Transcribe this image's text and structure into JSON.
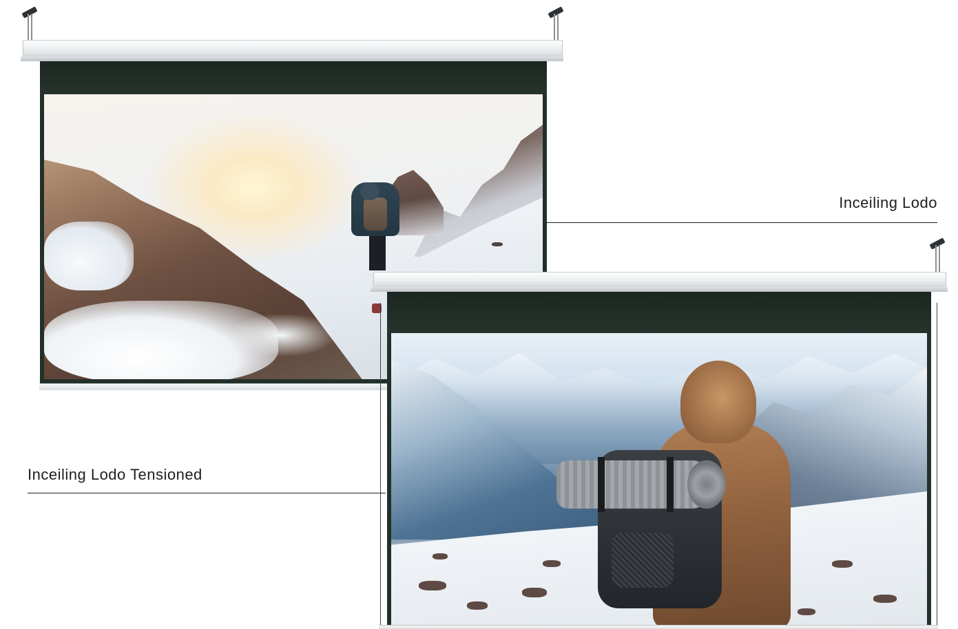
{
  "labels": {
    "top_product": "Inceiling Lodo",
    "bottom_product": "Inceiling Lodo Tensioned"
  },
  "icons": {
    "bracket": "ceiling-bracket-icon"
  },
  "colors": {
    "housing": "#eef0f1",
    "frame": "#22302a",
    "label_text": "#1e1e1e",
    "background": "#ffffff"
  }
}
